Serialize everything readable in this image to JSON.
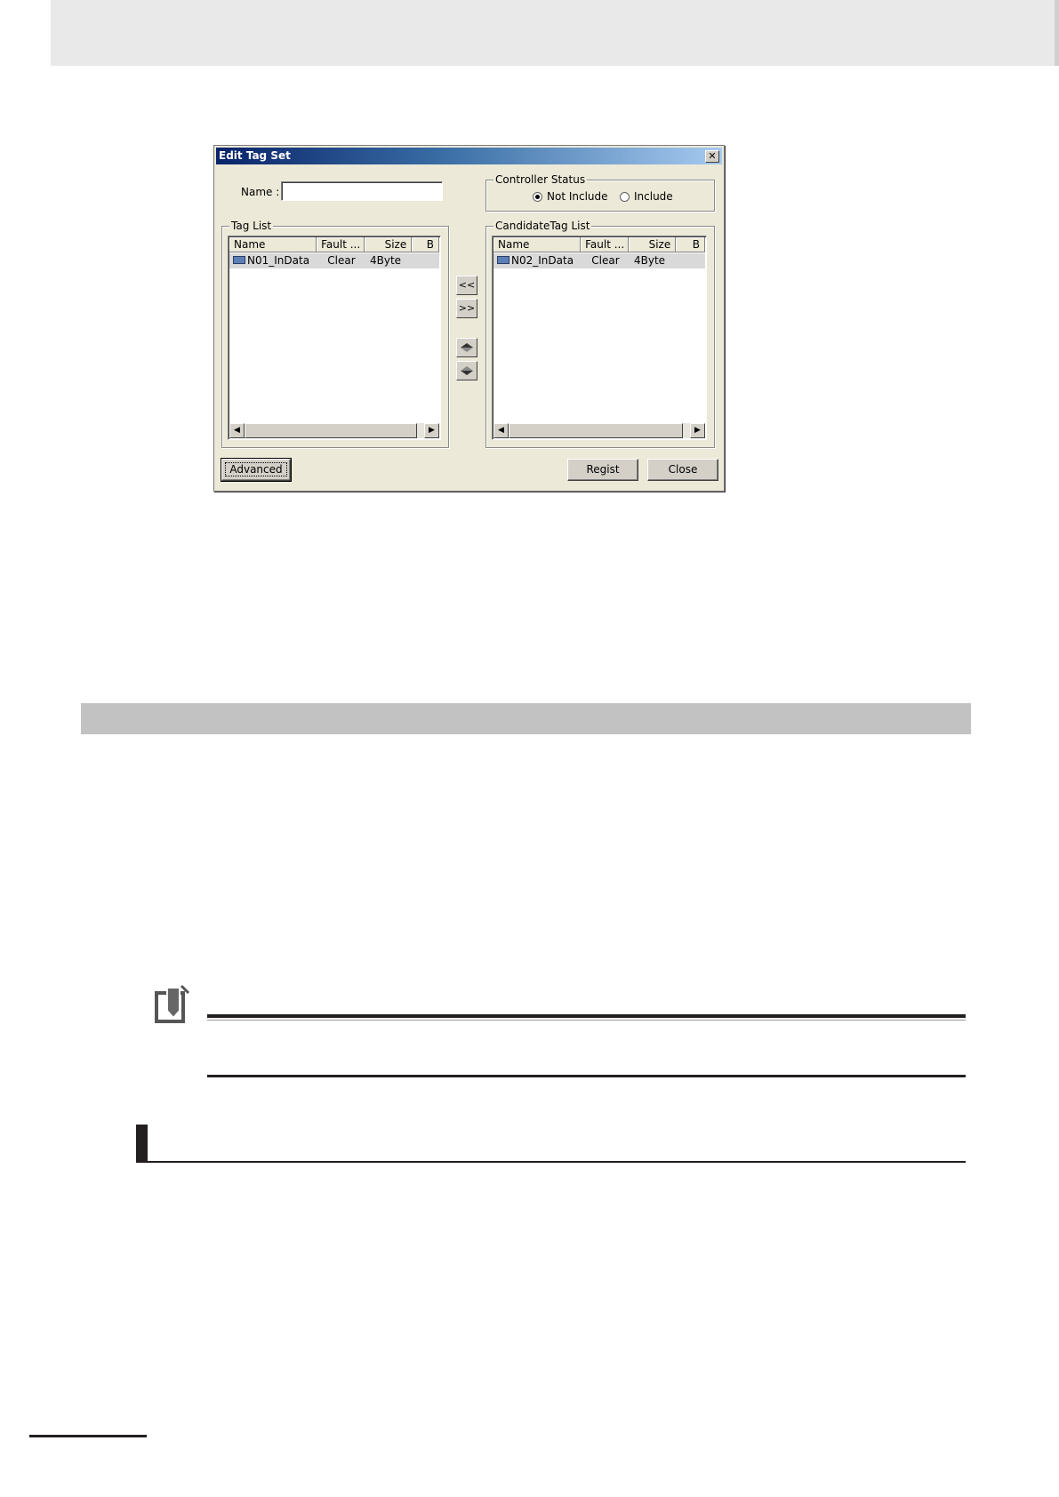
{
  "dialog": {
    "title": "Edit Tag Set",
    "close_glyph": "✕",
    "name_label": "Name :",
    "name_value": "",
    "controller_status": {
      "legend": "Controller Status",
      "options": [
        "Not Include",
        "Include"
      ],
      "selected": "Not Include"
    },
    "tag_list": {
      "legend": "Tag List",
      "columns": [
        "Name",
        "Fault ...",
        "Size",
        "B"
      ],
      "rows": [
        {
          "name": "N01_InData",
          "fault": "Clear",
          "size": "4Byte",
          "icon": "tag-icon"
        }
      ]
    },
    "candidate_list": {
      "legend": "CandidateTag List",
      "columns": [
        "Name",
        "Fault ...",
        "Size",
        "B"
      ],
      "rows": [
        {
          "name": "N02_InData",
          "fault": "Clear",
          "size": "4Byte",
          "icon": "tag-icon"
        }
      ]
    },
    "move_buttons": {
      "add": "<<",
      "remove": ">>"
    },
    "order_buttons": {
      "up_icon": "arrow-up-icon",
      "down_icon": "arrow-down-icon"
    },
    "buttons": {
      "advanced": "Advanced",
      "regist": "Regist",
      "close": "Close"
    },
    "scroll": {
      "left": "◀",
      "right": "▶"
    }
  }
}
